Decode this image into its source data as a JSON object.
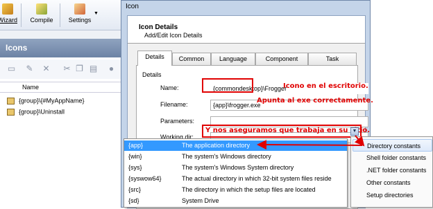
{
  "toolbar": {
    "wizard_label": "Wizard",
    "compile_label": "Compile",
    "settings_label": "Settings"
  },
  "panel": {
    "title": "Icons",
    "column_name": "Name",
    "rows": [
      "{group}\\{#MyAppName}",
      "{group}\\Uninstall"
    ]
  },
  "dialog": {
    "title": "Icon",
    "header_title": "Icon Details",
    "header_subtitle": "Add/Edit Icon Details",
    "tabs": [
      "Details",
      "Common",
      "Language",
      "Component",
      "Task"
    ],
    "active_tab": "Details",
    "group_label": "Details",
    "fields": {
      "name_label": "Name:",
      "name_value_boxed": "{commondesktop}",
      "name_value_rest": "\\Frogger",
      "filename_label": "Filename:",
      "filename_value": "{app}\\frogger.exe",
      "parameters_label": "Parameters:",
      "parameters_value": "",
      "workingdir_label": "Working dir:",
      "workingdir_value": ""
    }
  },
  "annotations": {
    "name_note": "Icono en el escritorio.",
    "filename_note": "Apunta al exe correctamente.",
    "workingdir_note": "Y nos aseguramos que trabaja en su sitio."
  },
  "directory_list": [
    {
      "key": "{app}",
      "desc": "The application directory",
      "selected": true
    },
    {
      "key": "{win}",
      "desc": "The system's Windows directory",
      "selected": false
    },
    {
      "key": "{sys}",
      "desc": "The system's Windows System directory",
      "selected": false
    },
    {
      "key": "{syswow64}",
      "desc": "The actual directory in which 32-bit system files reside",
      "selected": false
    },
    {
      "key": "{src}",
      "desc": "The directory in which the setup files are located",
      "selected": false
    },
    {
      "key": "{sd}",
      "desc": "System Drive",
      "selected": false
    }
  ],
  "context_menu": [
    {
      "label": "Directory constants",
      "highlighted": true
    },
    {
      "label": "Shell folder constants",
      "highlighted": false
    },
    {
      "label": ".NET folder constants",
      "highlighted": false
    },
    {
      "label": "Other constants",
      "highlighted": false
    },
    {
      "label": "Setup directories",
      "highlighted": false
    }
  ],
  "colors": {
    "annotation_red": "#e00000",
    "selection_blue": "#3399ff",
    "dialog_frame": "#c4d4e9"
  },
  "icons": [
    "wizard-icon",
    "compile-icon",
    "settings-icon",
    "new-icon",
    "edit-icon",
    "delete-icon",
    "cut-icon",
    "copy-icon",
    "paste-icon",
    "dropdown-icon"
  ]
}
